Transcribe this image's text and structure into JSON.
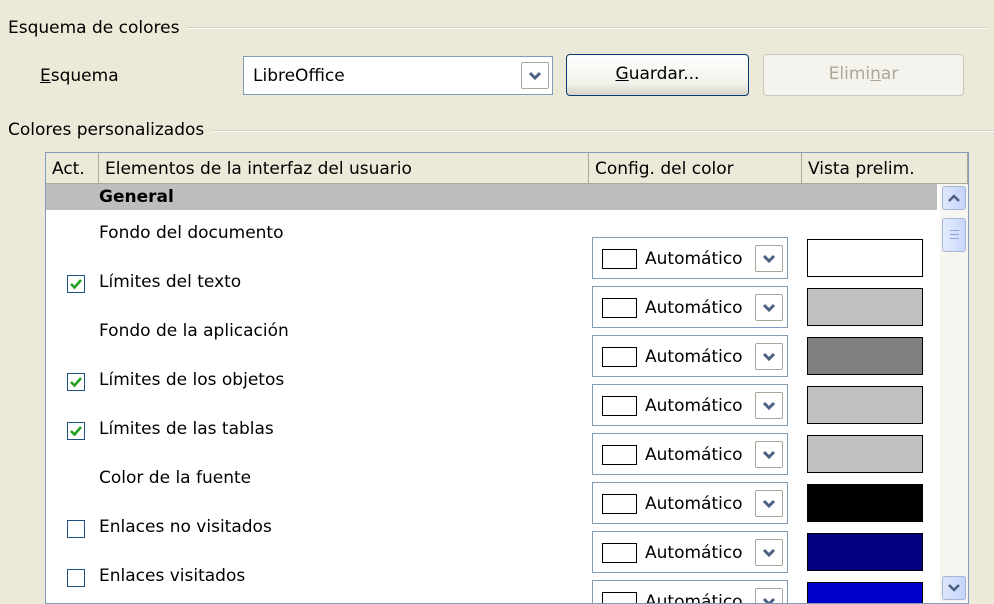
{
  "scheme_section": {
    "title": "Esquema de colores",
    "scheme_label": "Esquema",
    "scheme_value": "LibreOffice",
    "save_label": "Guardar...",
    "delete_label": "Eliminar"
  },
  "custom_section": {
    "title": "Colores personalizados"
  },
  "table": {
    "headers": {
      "active": "Act.",
      "element": "Elementos de la interfaz del usuario",
      "color": "Config. del color",
      "preview": "Vista prelim."
    },
    "category": "General",
    "color_value": "Automático",
    "rows": [
      {
        "label": "Fondo del documento",
        "has_checkbox": false,
        "checked": false,
        "preview_color": "#ffffff"
      },
      {
        "label": "Límites del texto",
        "has_checkbox": true,
        "checked": true,
        "preview_color": "#c0c0c0"
      },
      {
        "label": "Fondo de la aplicación",
        "has_checkbox": false,
        "checked": false,
        "preview_color": "#808080"
      },
      {
        "label": "Límites de los objetos",
        "has_checkbox": true,
        "checked": true,
        "preview_color": "#c0c0c0"
      },
      {
        "label": "Límites de las tablas",
        "has_checkbox": true,
        "checked": true,
        "preview_color": "#c0c0c0"
      },
      {
        "label": "Color de la fuente",
        "has_checkbox": false,
        "checked": false,
        "preview_color": "#000000"
      },
      {
        "label": "Enlaces no visitados",
        "has_checkbox": true,
        "checked": false,
        "preview_color": "#000080"
      },
      {
        "label": "Enlaces visitados",
        "has_checkbox": true,
        "checked": false,
        "preview_color": "#0000cc"
      }
    ]
  },
  "colors": {
    "dialog_bg": "#ece9d8",
    "category_bg": "#bdbdbd",
    "check_green": "#21a121",
    "field_border": "#7f9db9"
  }
}
